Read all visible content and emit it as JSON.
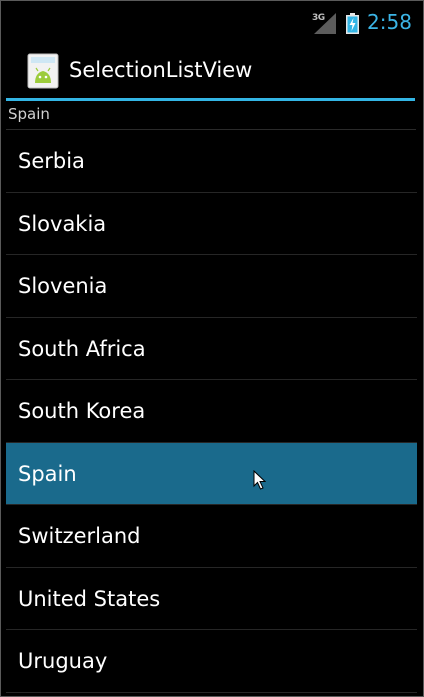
{
  "status_bar": {
    "network": "3G",
    "time": "2:58"
  },
  "action_bar": {
    "title": "SelectionListView",
    "icon": "android-app-icon"
  },
  "selection": {
    "current": "Spain"
  },
  "list": {
    "items": [
      {
        "label": "Serbia",
        "selected": false
      },
      {
        "label": "Slovakia",
        "selected": false
      },
      {
        "label": "Slovenia",
        "selected": false
      },
      {
        "label": "South Africa",
        "selected": false
      },
      {
        "label": "South Korea",
        "selected": false
      },
      {
        "label": "Spain",
        "selected": true
      },
      {
        "label": "Switzerland",
        "selected": false
      },
      {
        "label": "United States",
        "selected": false
      },
      {
        "label": "Uruguay",
        "selected": false
      }
    ]
  },
  "colors": {
    "accent": "#33b5e5",
    "selected_row": "#1a6a8c",
    "background": "#000000",
    "clock": "#3bb4e5"
  }
}
